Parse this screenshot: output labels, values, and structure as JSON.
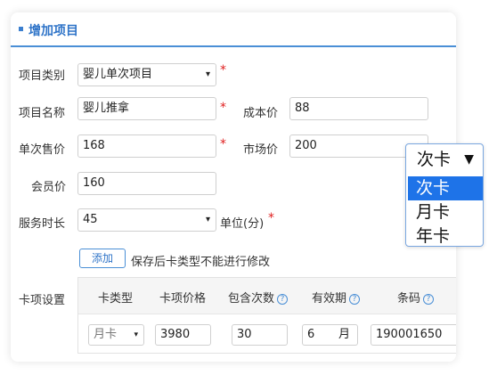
{
  "header": {
    "title": "增加项目"
  },
  "form": {
    "category_label": "项目类别",
    "category_value": "婴儿单次项目",
    "name_label": "项目名称",
    "name_value": "婴儿推拿",
    "cost_label": "成本价",
    "cost_value": "88",
    "single_price_label": "单次售价",
    "single_price_value": "168",
    "market_price_label": "市场价",
    "market_price_value": "200",
    "member_price_label": "会员价",
    "member_price_value": "160",
    "duration_label": "服务时长",
    "duration_value": "45",
    "duration_unit": "单位(分)",
    "required_mark": "*"
  },
  "card_settings": {
    "add_button": "添加",
    "note": "保存后卡类型不能进行修改",
    "section_label": "卡项设置",
    "columns": [
      "卡类型",
      "卡项价格",
      "包含次数",
      "有效期",
      "条码"
    ],
    "help_glyph": "?",
    "row": {
      "card_type": "月卡",
      "price": "3980",
      "count": "30",
      "validity": "6",
      "validity_unit": "月",
      "barcode": "190001650"
    }
  },
  "dropdown": {
    "current": "次卡",
    "options": [
      "次卡",
      "月卡",
      "年卡"
    ],
    "selected_index": 0
  },
  "icons": {
    "select_arrow": "▾",
    "dropdown_caret": "▼"
  },
  "colors": {
    "accent": "#2f74c8",
    "required": "#e02020",
    "selected_option": "#1e73e8"
  }
}
